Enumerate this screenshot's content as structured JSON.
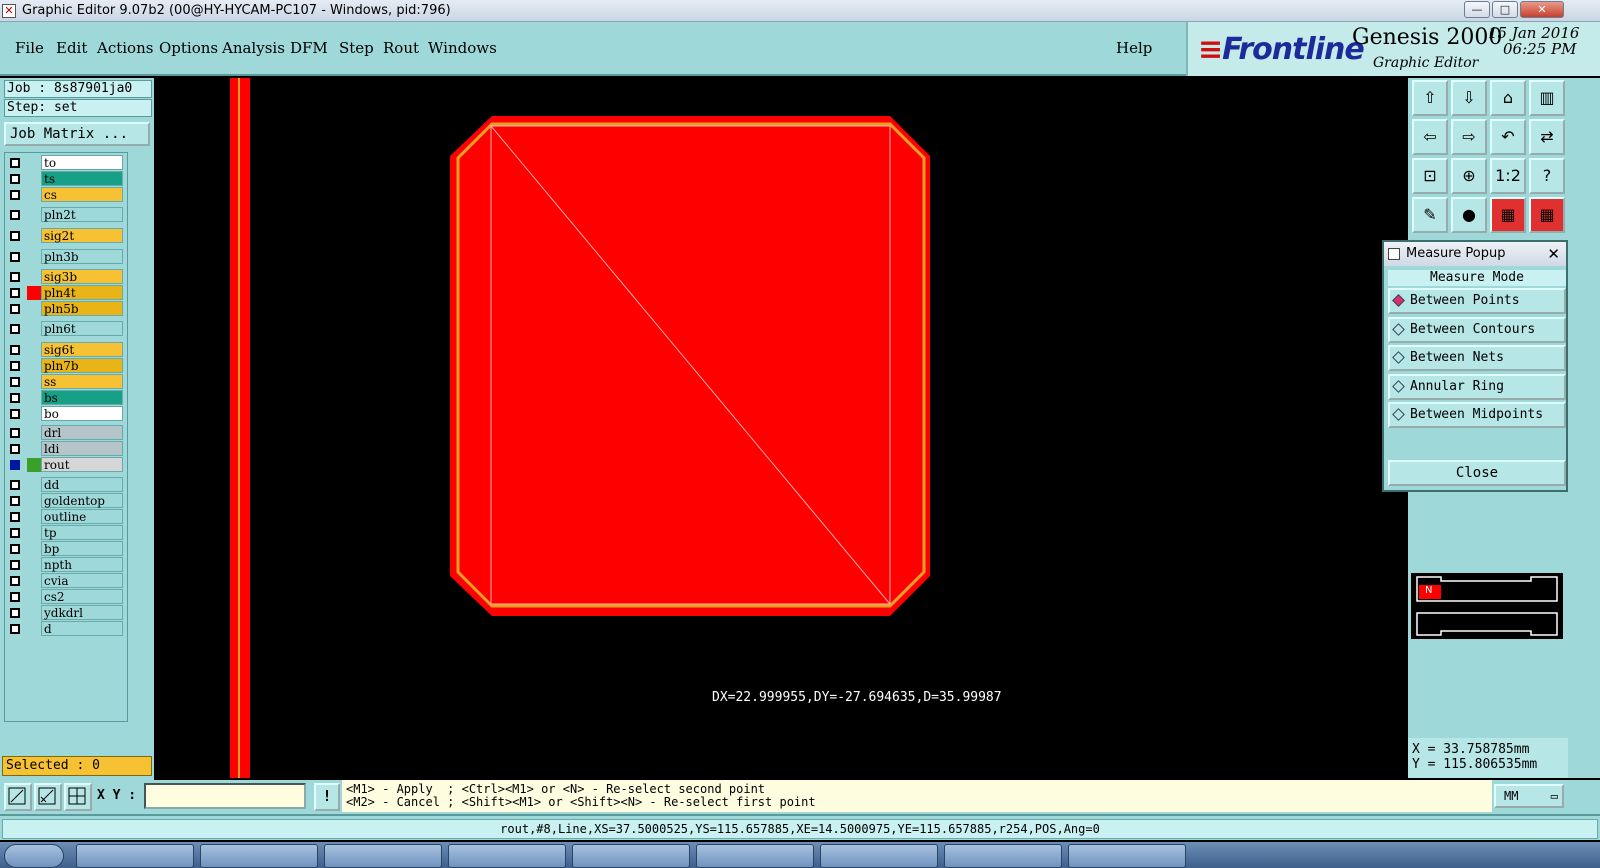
{
  "window": {
    "title": "Graphic Editor 9.07b2 (00@HY-HYCAM-PC107 - Windows, pid:796)",
    "controls": {
      "minimize": "—",
      "maximize": "□",
      "close": "✕"
    }
  },
  "menu": {
    "items": [
      "File",
      "Edit",
      "Actions",
      "Options",
      "Analysis",
      "DFM",
      "Step",
      "Rout",
      "Windows"
    ],
    "help": "Help"
  },
  "brand": {
    "logo": "Frontline",
    "product": "Genesis 2000",
    "subtitle": "Graphic Editor",
    "date": "15 Jan 2016",
    "time": "06:25 PM"
  },
  "job": {
    "job_label": "Job : 8s87901ja0",
    "step_label": "Step: set",
    "matrix_button": "Job Matrix ..."
  },
  "layers": [
    {
      "name": "to",
      "color": "#ffffff",
      "active": false,
      "swatch": ""
    },
    {
      "name": "ts",
      "color": "#17a085",
      "active": false,
      "swatch": ""
    },
    {
      "name": "cs",
      "color": "#f6c233",
      "active": false,
      "swatch": ""
    },
    {
      "name": "pln2t",
      "color": "#9fd8d8",
      "active": false,
      "swatch": ""
    },
    {
      "name": "sig2t",
      "color": "#f6c233",
      "active": false,
      "swatch": ""
    },
    {
      "name": "pln3b",
      "color": "#9fd8d8",
      "active": false,
      "swatch": ""
    },
    {
      "name": "sig3b",
      "color": "#f6c233",
      "active": false,
      "swatch": ""
    },
    {
      "name": "pln4t",
      "color": "#e8b418",
      "active": false,
      "swatch": "#ff0000"
    },
    {
      "name": "pln5b",
      "color": "#e8b418",
      "active": false,
      "swatch": ""
    },
    {
      "name": "pln6t",
      "color": "#9fd8d8",
      "active": false,
      "swatch": ""
    },
    {
      "name": "sig6t",
      "color": "#f6c233",
      "active": false,
      "swatch": ""
    },
    {
      "name": "pln7b",
      "color": "#e8b418",
      "active": false,
      "swatch": ""
    },
    {
      "name": "ss",
      "color": "#f6c233",
      "active": false,
      "swatch": ""
    },
    {
      "name": "bs",
      "color": "#17a085",
      "active": false,
      "swatch": ""
    },
    {
      "name": "bo",
      "color": "#ffffff",
      "active": false,
      "swatch": ""
    },
    {
      "name": "drl",
      "color": "#b5c4c8",
      "active": false,
      "swatch": ""
    },
    {
      "name": "ldi",
      "color": "#b5c4c8",
      "active": false,
      "swatch": ""
    },
    {
      "name": "rout",
      "color": "#d6d6d6",
      "active": true,
      "swatch": "#3aa02a"
    },
    {
      "name": "dd",
      "color": "#9fd8d8",
      "active": false,
      "swatch": ""
    },
    {
      "name": "goldentop",
      "color": "#9fd8d8",
      "active": false,
      "swatch": ""
    },
    {
      "name": "outline",
      "color": "#9fd8d8",
      "active": false,
      "swatch": ""
    },
    {
      "name": "tp",
      "color": "#9fd8d8",
      "active": false,
      "swatch": ""
    },
    {
      "name": "bp",
      "color": "#9fd8d8",
      "active": false,
      "swatch": ""
    },
    {
      "name": "npth",
      "color": "#9fd8d8",
      "active": false,
      "swatch": ""
    },
    {
      "name": "cvia",
      "color": "#9fd8d8",
      "active": false,
      "swatch": ""
    },
    {
      "name": "cs2",
      "color": "#9fd8d8",
      "active": false,
      "swatch": ""
    },
    {
      "name": "ydkdrl",
      "color": "#9fd8d8",
      "active": false,
      "swatch": ""
    },
    {
      "name": "d",
      "color": "#9fd8d8",
      "active": false,
      "swatch": ""
    }
  ],
  "selected": "Selected : 0",
  "canvas": {
    "measurement": "DX=22.999955,DY=-27.694635,D=35.99987",
    "fill_color": "#ff0000",
    "outline_color": "#e8a020"
  },
  "measure_popup": {
    "title": "Measure Popup",
    "header": "Measure Mode",
    "options": [
      {
        "label": "Between Points",
        "selected": true
      },
      {
        "label": "Between Contours",
        "selected": false
      },
      {
        "label": "Between Nets",
        "selected": false
      },
      {
        "label": "Annular Ring",
        "selected": false
      },
      {
        "label": "Between Midpoints",
        "selected": false
      }
    ],
    "close": "Close"
  },
  "coords": {
    "x": "X = 33.758785mm",
    "y": "Y = 115.806535mm"
  },
  "overview_label": "N",
  "command": {
    "xy_label": "X Y :",
    "xy_value": "",
    "bang": "!",
    "hint1": "<M1> - Apply  ; <Ctrl><M1> or <N> - Re-select second point",
    "hint2": "<M2> - Cancel ; <Shift><M1> or <Shift><N> - Re-select first point",
    "units": "MM"
  },
  "status": "rout,#8,Line,XS=37.5000525,YS=115.657885,XE=14.5000975,YE=115.657885,r254,POS,Ang=0"
}
